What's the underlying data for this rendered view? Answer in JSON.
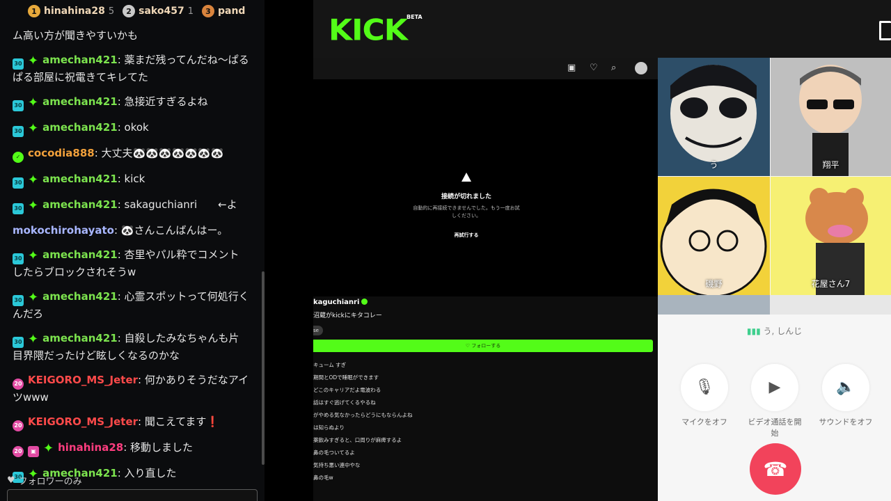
{
  "chat": {
    "top_gifters": [
      {
        "rank": "1",
        "name": "hinahina28",
        "count": "5"
      },
      {
        "rank": "2",
        "name": "sako457",
        "count": "1"
      },
      {
        "rank": "3",
        "name": "pand",
        "count": ""
      }
    ],
    "partial_message": "ム高い方が聞きやすいかも",
    "messages": [
      {
        "badge": "30",
        "user": "amechan421",
        "text": "薬まだ残ってんだね〜ぱるぱる部屋に祝電きてキレてた"
      },
      {
        "badge": "30",
        "user": "amechan421",
        "text": "急接近すぎるよね"
      },
      {
        "badge": "30",
        "user": "amechan421",
        "text": "okok"
      },
      {
        "badge": "✓",
        "user": "cocodia888",
        "text": "大丈夫🐼🐼🐼🐼🐼🐼🐼"
      },
      {
        "badge": "30",
        "user": "amechan421",
        "text": "kick"
      },
      {
        "badge": "30",
        "user": "amechan421",
        "text": "sakaguchianri　　←よ"
      },
      {
        "badge": "",
        "user": "mokochirohayato",
        "text": "🐼さんこんばんはー。"
      },
      {
        "badge": "30",
        "user": "amechan421",
        "text": "杏里やパル粋でコメントしたらブロックされそうw"
      },
      {
        "badge": "30",
        "user": "amechan421",
        "text": "心霊スポットって何処行くんだろ"
      },
      {
        "badge": "30",
        "user": "amechan421",
        "text": "自殺したみなちゃんも片目界隈だったけど眩しくなるのかな"
      },
      {
        "badge": "20",
        "user": "KEIGORO_MS_Jeter",
        "text": "何かありそうだなアイツwww"
      },
      {
        "badge": "20",
        "user": "KEIGORO_MS_Jeter",
        "text": "聞こえてます",
        "suffix": "❗"
      },
      {
        "badge": "20",
        "user": "hinahina28",
        "text": "移動しました"
      },
      {
        "badge": "30",
        "user": "amechan421",
        "text": "入り直した"
      }
    ],
    "follower_only": "フォロワーのみ"
  },
  "kick": {
    "logo": "KICK",
    "beta": "BETA",
    "player": {
      "error_title": "接続が切れました",
      "error_sub": "自動的に再接続できませんでした。もう一度お試しください。",
      "retry": "再試行する"
    },
    "streamer": "kaguchianri",
    "stream_title": "沼蔵がkickにキタコレー",
    "tag": "se",
    "follow": "♡ フォローする",
    "mini_chat": [
      "キューム すぎ",
      "期間とODで睡眠ができます",
      "どこのキャリアだよ電波わる",
      "話はすぐ逃げてくるやるね",
      "がやめる気なかったらどうにもならんよね",
      "は知らぬより",
      "薬飲みすぎると、口周りが麻痺するよ",
      "鼻の毛ついてるよ",
      "気持ち悪い連中やな",
      "鼻の毛w"
    ]
  },
  "call": {
    "participants": [
      {
        "name": "う"
      },
      {
        "name": "翔平"
      },
      {
        "name": "磯野"
      },
      {
        "name": "花屋さん7"
      }
    ],
    "speaking": "う, しんじ",
    "controls": [
      {
        "icon": "microphone-icon",
        "label": "マイクをオフ"
      },
      {
        "icon": "video-camera-icon",
        "label": "ビデオ通話を開始"
      },
      {
        "icon": "speaker-icon",
        "label": "サウンドをオフ"
      }
    ],
    "end_icon": "phone-hangup-icon",
    "end_color": "#f2435b"
  },
  "colors": {
    "kick_green": "#53fc18",
    "chat_bg": "#0b0c0e"
  }
}
